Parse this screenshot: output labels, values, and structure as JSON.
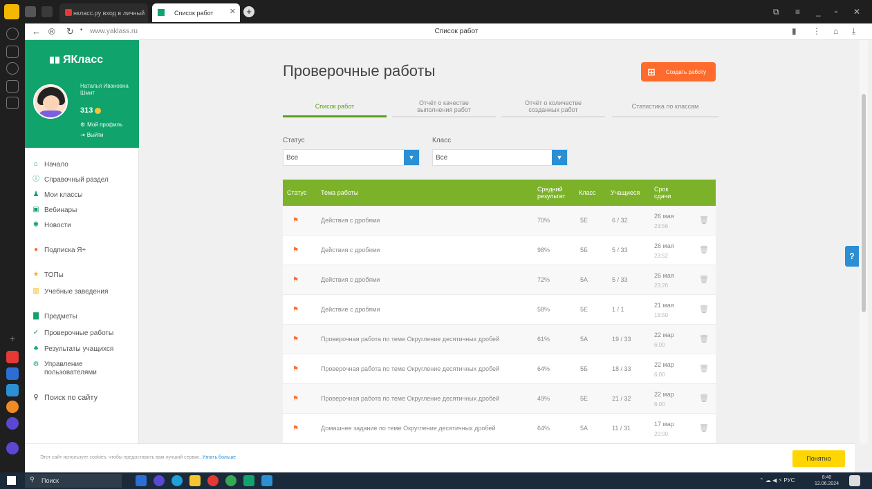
{
  "browser": {
    "tabs": [
      {
        "label": "нкласс.ру вход в личный"
      },
      {
        "label": "Список работ"
      }
    ],
    "url": "www.yaklass.ru",
    "page_title": "Список работ"
  },
  "sidebar": {
    "brand": "ЯКласс",
    "user_name": "Наталья Ивановна Шмит",
    "points": "313",
    "profile_link": "Мой профиль",
    "logout_link": "Выйти",
    "menu": [
      {
        "label": "Начало",
        "icon": "home-icon"
      },
      {
        "label": "Справочный раздел",
        "icon": "info-icon"
      },
      {
        "label": "Мои классы",
        "icon": "classes-icon"
      },
      {
        "label": "Вебинары",
        "icon": "webinar-icon"
      },
      {
        "label": "Новости",
        "icon": "news-icon"
      },
      {
        "label": "Подписка Я+",
        "icon": "subscription-icon"
      },
      {
        "label": "ТОПы",
        "icon": "star-icon"
      },
      {
        "label": "Учебные заведения",
        "icon": "school-icon"
      },
      {
        "label": "Предметы",
        "icon": "books-icon"
      },
      {
        "label": "Проверочные работы",
        "icon": "check-icon"
      },
      {
        "label": "Результаты учащихся",
        "icon": "students-icon"
      },
      {
        "label": "Управление пользователями",
        "icon": "users-manage-icon"
      },
      {
        "label": "Поиск по сайту",
        "icon": "search-icon"
      }
    ]
  },
  "main": {
    "title": "Проверочные работы",
    "create_button": "Создать работу",
    "tabs": [
      {
        "label": "Список работ"
      },
      {
        "label": "Отчёт о качестве выполнения работ"
      },
      {
        "label": "Отчёт о количестве созданных работ"
      },
      {
        "label": "Статистика по классам"
      }
    ],
    "filters": {
      "status_label": "Статус",
      "status_value": "Все",
      "class_label": "Класс",
      "class_value": "Все"
    },
    "table": {
      "headers": [
        "Статус",
        "Тема работы",
        "Средний результат",
        "Класс",
        "Учащиеся",
        "Срок сдачи"
      ],
      "rows": [
        {
          "topic": "Действия с дробями",
          "result": "70%",
          "class": "5Е",
          "students": "6 / 32",
          "date": "26 мая",
          "time": "23:56"
        },
        {
          "topic": "Действия с дробями",
          "result": "98%",
          "class": "5Б",
          "students": "5 / 33",
          "date": "26 мая",
          "time": "23:52"
        },
        {
          "topic": "Действия с дробями",
          "result": "72%",
          "class": "5А",
          "students": "5 / 33",
          "date": "26 мая",
          "time": "23:26"
        },
        {
          "topic": "Действие с дробями",
          "result": "58%",
          "class": "5Е",
          "students": "1 / 1",
          "date": "21 мая",
          "time": "19:50"
        },
        {
          "topic": "Проверочная работа по теме Округление десятичных дробей",
          "result": "61%",
          "class": "5А",
          "students": "19 / 33",
          "date": "22 мар",
          "time": "6:00"
        },
        {
          "topic": "Проверочная работа по теме Округление десятичных дробей",
          "result": "64%",
          "class": "5Б",
          "students": "18 / 33",
          "date": "22 мар",
          "time": "6:00"
        },
        {
          "topic": "Проверочная работа по теме Округление десятичных дробей",
          "result": "49%",
          "class": "5Е",
          "students": "21 / 32",
          "date": "22 мар",
          "time": "6:00"
        },
        {
          "topic": "Домашнее задание по теме Округление десятичных дробей",
          "result": "64%",
          "class": "5А",
          "students": "11 / 31",
          "date": "17 мар",
          "time": "20:00"
        }
      ]
    }
  },
  "cookie": {
    "text": "Этот сайт использует cookies, чтобы предоставить вам лучший сервис.",
    "more": "Узнать больше",
    "accept": "Понятно"
  },
  "help": "?",
  "taskbar": {
    "search": "Поиск",
    "lang": "РУС",
    "time": "8:40",
    "date": "12.06.2024"
  },
  "colors": {
    "brand_green": "#11a36c",
    "table_header": "#7cb22a",
    "accent_orange": "#ff6b2c",
    "select_blue": "#2b8fd4",
    "cookie_button": "#ffd600"
  }
}
